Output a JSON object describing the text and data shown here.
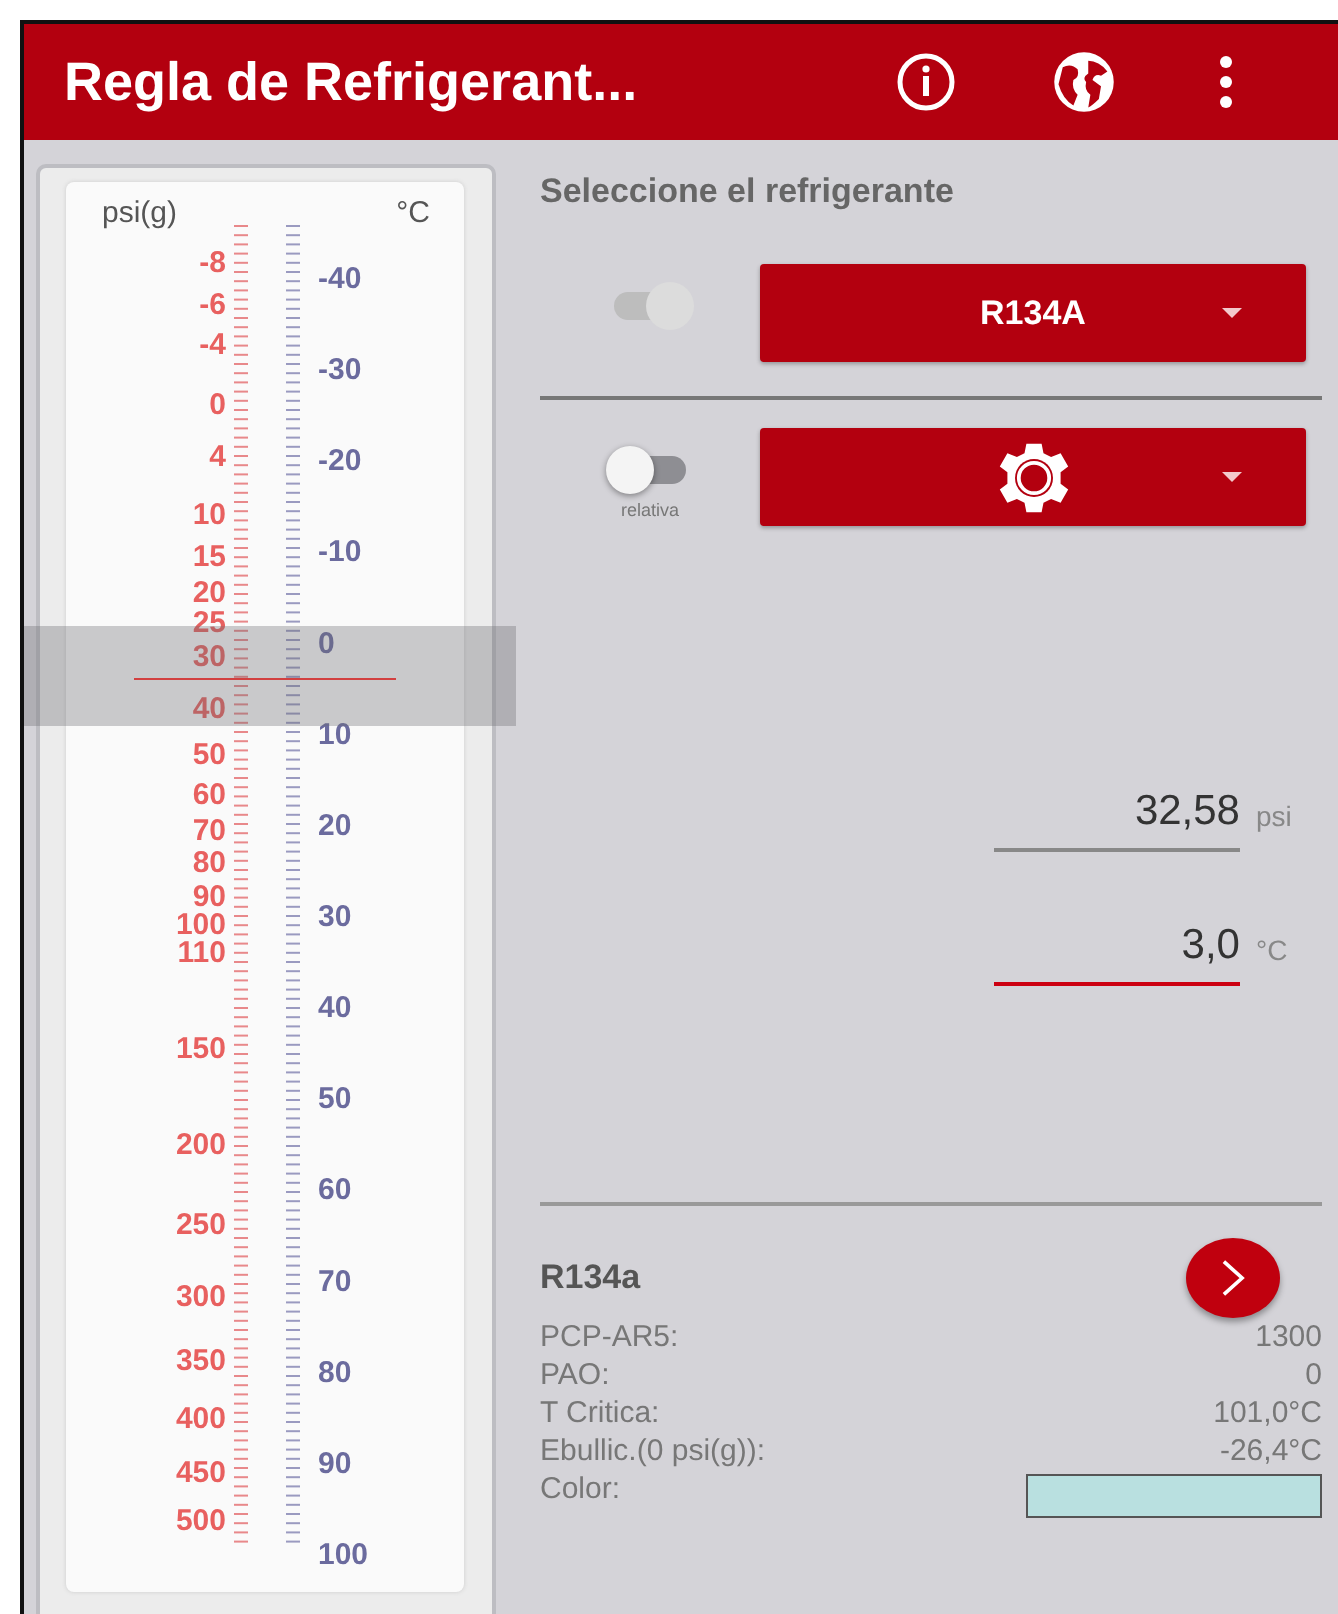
{
  "app_bar": {
    "title": "Regla de Refrigerant..."
  },
  "ruler": {
    "left_unit": "psi(g)",
    "right_unit": "°C",
    "psi_labels": [
      "-8",
      "-6",
      "-4",
      "0",
      "4",
      "10",
      "15",
      "20",
      "25",
      "30",
      "40",
      "50",
      "60",
      "70",
      "80",
      "90",
      "100",
      "110",
      "150",
      "200",
      "250",
      "300",
      "350",
      "400",
      "450",
      "500"
    ],
    "celsius_labels": [
      "-40",
      "-30",
      "-20",
      "-10",
      "0",
      "10",
      "20",
      "30",
      "40",
      "50",
      "60",
      "70",
      "80",
      "90",
      "100"
    ]
  },
  "heading": "Seleccione el refrigerante",
  "rows": [
    {
      "kind": "refrigerant",
      "toggle": {
        "on": true,
        "disabled": true
      },
      "dropdown": {
        "value": "R134A"
      }
    },
    {
      "kind": "settings",
      "toggle": {
        "on": false,
        "disabled": false,
        "label": "relativa"
      },
      "dropdown": {}
    }
  ],
  "fields": [
    {
      "value": "32,58",
      "unit": "psi",
      "focused": false
    },
    {
      "value": "3,0",
      "unit": "°C",
      "focused": true
    }
  ],
  "info": {
    "name": "R134a",
    "properties": [
      {
        "label": "PCP-AR5:",
        "value": "1300"
      },
      {
        "label": "PAO:",
        "value": "0"
      },
      {
        "label": "T Critica:",
        "value": "101,0°C"
      },
      {
        "label": "Ebullic.(0 psi(g)):",
        "value": "-26,4°C"
      },
      {
        "label": "Color:",
        "kind": "swatch",
        "color": "#b9e0e0"
      }
    ]
  }
}
